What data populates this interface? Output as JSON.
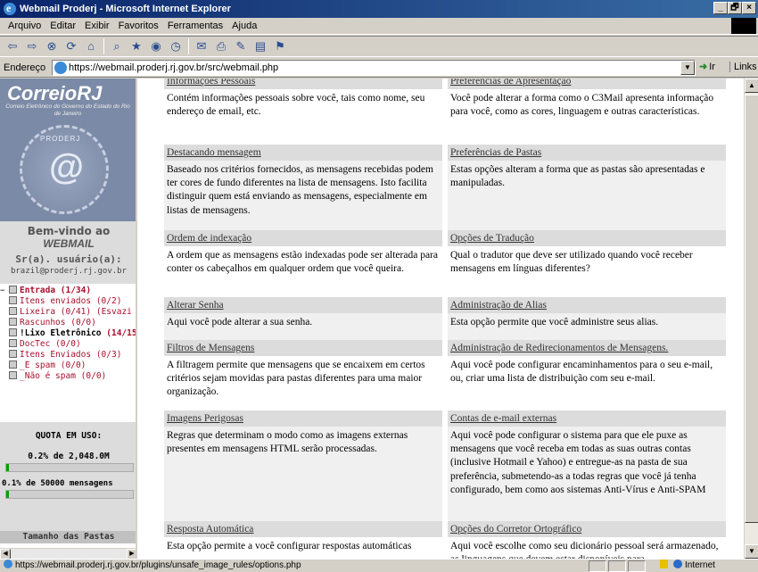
{
  "window": {
    "title": "Webmail Proderj - Microsoft Internet Explorer",
    "controls": [
      "_",
      "🗗",
      "×"
    ]
  },
  "menubar": [
    "Arquivo",
    "Editar",
    "Exibir",
    "Favoritos",
    "Ferramentas",
    "Ajuda"
  ],
  "address": {
    "label": "Endereço",
    "url": "https://webmail.proderj.rj.gov.br/src/webmail.php",
    "go_label": "Ir",
    "links_label": "Links"
  },
  "sidebar": {
    "brand_name": "CorreioRJ",
    "brand_sub": "Correio Eletrônico do Governo do Estado do Rio de Janeiro",
    "stamp_text": "PRODERJ",
    "welcome_1": "Bem-vindo ao",
    "welcome_2": "WEBMAIL",
    "user_label": "Sr(a). usuário(a):",
    "user_email": "brazil@proderj.rj.gov.br",
    "folders": [
      {
        "name": "Entrada",
        "count": "(1/34)",
        "bold": true
      },
      {
        "name": "Itens enviados",
        "count": "(0/2)",
        "bold": false
      },
      {
        "name": "Lixeira",
        "count": "(0/41)",
        "extra": "(Esvazi",
        "bold": false
      },
      {
        "name": "Rascunhos",
        "count": "(0/0)",
        "bold": false
      },
      {
        "name": "!Lixo Eletrônico",
        "count": "(14/15)",
        "bold": true,
        "black": true
      },
      {
        "name": "DocTec",
        "count": "(0/0)",
        "bold": false
      },
      {
        "name": "Itens Enviados",
        "count": "(0/3)",
        "bold": false
      },
      {
        "name": "_É spam",
        "count": "(0/0)",
        "bold": false
      },
      {
        "name": "_Não é spam",
        "count": "(0/0)",
        "bold": false
      }
    ],
    "quota_title": "QUOTA EM USO:",
    "quota_size": "0.2% de 2,048.0M",
    "quota_size_percent": 0.2,
    "quota_messages": "0.1% de 50000 mensagens",
    "quota_messages_percent": 0.1,
    "folder_size_button": "Tamanho das Pastas"
  },
  "options": {
    "left": [
      {
        "title": "Informações Pessoais",
        "desc": "Contém informações pessoais sobre você, tais como nome, seu endereço de email, etc."
      },
      {
        "title": "Destacando mensagem",
        "desc": "Baseado nos critérios fornecidos, as mensagens recebidas podem ter cores de fundo diferentes na lista de mensagens. Isto facilita distinguir quem está enviando as mensagens, especialmente em listas de mensagens."
      },
      {
        "title": "Ordem de indexação",
        "desc": "A ordem que as mensagens estão indexadas pode ser alterada para conter os cabeçalhos em qualquer ordem que você queira."
      },
      {
        "title": "Alterar Senha",
        "desc": "Aqui você pode alterar a sua senha."
      },
      {
        "title": "Filtros de Mensagens",
        "desc": "A filtragem permite que mensagens que se encaixem em certos critérios sejam movidas para pastas diferentes para uma maior organização."
      },
      {
        "title": "Imagens Perigosas",
        "desc": "Regras que determinam o modo como as imagens externas presentes em mensagens HTML serão processadas."
      },
      {
        "title": "Resposta Automática",
        "desc": "Esta opção permite a você configurar respostas automáticas"
      }
    ],
    "right": [
      {
        "title": "Preferências de Apresentação",
        "desc": "Você pode alterar a forma como o C3Mail apresenta informação para você, como as cores, linguagem e outras características."
      },
      {
        "title": "Preferências de Pastas",
        "desc": "Estas opções alteram a forma que as pastas são apresentadas e manipuladas."
      },
      {
        "title": "Opções de Tradução",
        "desc": "Qual o tradutor que deve ser utilizado quando você receber mensagens em línguas diferentes?"
      },
      {
        "title": "Administração de Alias",
        "desc": "Esta opção permite que você administre seus alias."
      },
      {
        "title": "Administração de Redirecionamentos de Mensagens.",
        "desc": "Aqui você pode configurar encaminhamentos para o seu e-mail, ou, criar uma lista de distribuição com seu e-mail."
      },
      {
        "title": "Contas de e-mail externas",
        "desc": "Aqui você pode configurar o sistema para que ele puxe as mensagens que você receba em todas as suas outras contas (inclusive Hotmail e Yahoo) e entregue-as na pasta de sua preferência, submetendo-as a todas regras que você já tenha configurado, bem como aos sistemas Anti-Vírus e Anti-SPAM"
      },
      {
        "title": "Opções do Corretor Ortográfico",
        "desc": "Aqui você escolhe como seu dicionário pessoal será armazenado, as linguagens que devem estar disponíveis para"
      }
    ]
  },
  "status": {
    "url": "https://webmail.proderj.rj.gov.br/plugins/unsafe_image_rules/options.php",
    "zone": "Internet"
  }
}
